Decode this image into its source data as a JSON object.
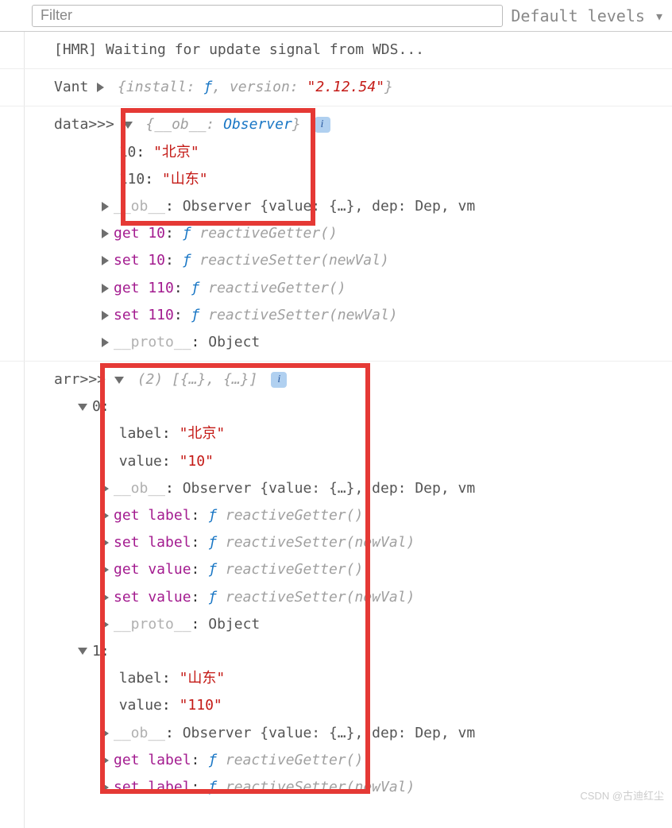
{
  "toolbar": {
    "filter_placeholder": "Filter",
    "levels_label": "Default levels"
  },
  "log1": {
    "text": "[HMR] Waiting for update signal from WDS..."
  },
  "log2": {
    "prefix": "Vant ",
    "install_key": "install",
    "install_val": "ƒ",
    "version_key": "version",
    "version_val": "\"2.12.54\""
  },
  "data_block": {
    "label": "data>>> ",
    "header_ob": "__ob__",
    "header_type": "Observer",
    "k10": "10",
    "v10": "\"北京\"",
    "k110": "110",
    "v110": "\"山东\"",
    "ob_key": "__ob__",
    "ob_type": "Observer",
    "ob_tail": " {value: {…}, dep: Dep, vm",
    "get10": "get 10",
    "set10": "set 10",
    "get110": "get 110",
    "set110": "set 110",
    "reactiveGetter": "reactiveGetter()",
    "reactiveSetter": "reactiveSetter(newVal)",
    "proto_key": "__proto__",
    "proto_val": "Object",
    "f": "ƒ"
  },
  "arr_block": {
    "label": "arr>>> ",
    "count": "(2)",
    "summary": " [{…}, {…}]",
    "idx0": "0",
    "idx1": "1",
    "label_key": "label",
    "value_key": "value",
    "beijing": "\"北京\"",
    "shandong": "\"山东\"",
    "v10": "\"10\"",
    "v110": "\"110\"",
    "ob_key": "__ob__",
    "ob_type": "Observer",
    "ob_tail": " {value: {…}, dep: Dep, vm",
    "get_label": "get label",
    "set_label": "set label",
    "get_value": "get value",
    "set_value": "set value",
    "reactiveGetter": "reactiveGetter()",
    "reactiveSetter": "reactiveSetter(newVal)",
    "proto_key": "__proto__",
    "proto_val": "Object",
    "f": "ƒ"
  },
  "watermark": "CSDN @古迪红尘"
}
